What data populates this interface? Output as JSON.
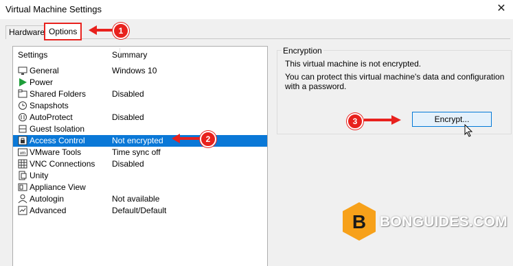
{
  "window": {
    "title": "Virtual Machine Settings",
    "close_glyph": "✕"
  },
  "tabs": [
    {
      "label": "Hardware"
    },
    {
      "label": "Options"
    }
  ],
  "settings_list": {
    "headers": {
      "settings": "Settings",
      "summary": "Summary"
    },
    "selected_index": 6,
    "items": [
      {
        "label": "General",
        "summary": "Windows 10",
        "icon": "monitor-icon"
      },
      {
        "label": "Power",
        "summary": "",
        "icon": "play-icon"
      },
      {
        "label": "Shared Folders",
        "summary": "Disabled",
        "icon": "folder-share-icon"
      },
      {
        "label": "Snapshots",
        "summary": "",
        "icon": "snapshot-icon"
      },
      {
        "label": "AutoProtect",
        "summary": "Disabled",
        "icon": "autoprotect-icon"
      },
      {
        "label": "Guest Isolation",
        "summary": "",
        "icon": "isolation-icon"
      },
      {
        "label": "Access Control",
        "summary": "Not encrypted",
        "icon": "lock-icon"
      },
      {
        "label": "VMware Tools",
        "summary": "Time sync off",
        "icon": "vm-icon"
      },
      {
        "label": "VNC Connections",
        "summary": "Disabled",
        "icon": "network-icon"
      },
      {
        "label": "Unity",
        "summary": "",
        "icon": "unity-icon"
      },
      {
        "label": "Appliance View",
        "summary": "",
        "icon": "appliance-icon"
      },
      {
        "label": "Autologin",
        "summary": "Not available",
        "icon": "user-icon"
      },
      {
        "label": "Advanced",
        "summary": "Default/Default",
        "icon": "advanced-icon"
      }
    ]
  },
  "encryption": {
    "group_title": "Encryption",
    "status": "This virtual machine is not encrypted.",
    "description_line1": "You can protect this virtual machine's data and configuration",
    "description_line2": "with a password.",
    "encrypt_button": "Encrypt..."
  },
  "annotations": {
    "step1": "1",
    "step2": "2",
    "step3": "3",
    "color": "#e8211d"
  },
  "brand": {
    "logo_letter": "B",
    "name": "BONGUIDES.COM",
    "color": "#f7a11a"
  },
  "colors": {
    "selection": "#0a78d7",
    "button_border": "#0078d7"
  }
}
